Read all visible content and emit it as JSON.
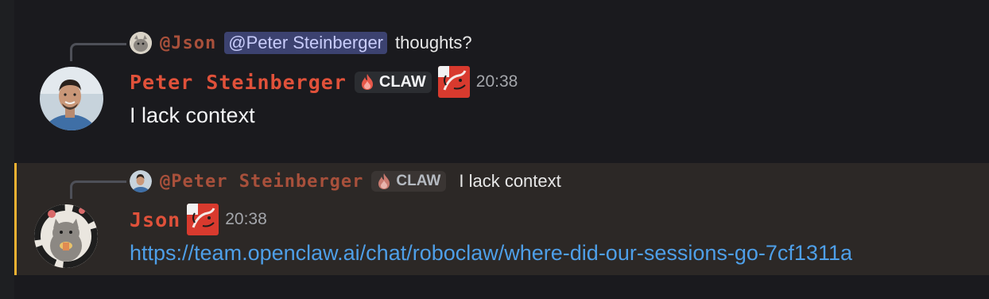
{
  "messages": [
    {
      "reply": {
        "author": "@Json",
        "mention": "@Peter Steinberger",
        "text": "thoughts?"
      },
      "author": "Peter Steinberger",
      "tag": "CLAW",
      "timestamp": "20:38",
      "content": "I lack context"
    },
    {
      "reply": {
        "author": "@Peter Steinberger",
        "tag": "CLAW",
        "text": "I lack context"
      },
      "author": "Json",
      "timestamp": "20:38",
      "content": "https://team.openclaw.ai/chat/roboclaw/where-did-our-sessions-go-7cf1311a"
    }
  ],
  "colors": {
    "background": "#1a1a1e",
    "highlight_background": "#2c2826",
    "highlight_border": "#f0b232",
    "author_name": "#e0513a",
    "reply_author": "#a8503b",
    "mention_bg": "#3c4270",
    "mention_text": "#c9cdfb",
    "link": "#4e9fe8",
    "timestamp": "#a4a6ab"
  },
  "icons": {
    "tag_icon": "fire-icon",
    "role_icon": "lobster-icon"
  }
}
